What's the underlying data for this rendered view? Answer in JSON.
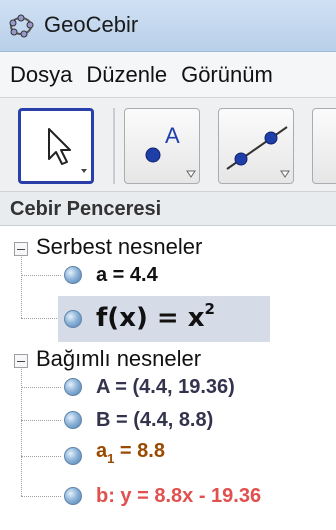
{
  "window": {
    "title": "GeoCebir",
    "icon": "geogebra-app-icon"
  },
  "menu": {
    "items": [
      "Dosya",
      "Düzenle",
      "Görünüm"
    ]
  },
  "toolbar": {
    "tools": [
      {
        "name": "move-tool",
        "icon": "arrow-cursor-icon",
        "selected": true
      },
      {
        "name": "point-tool",
        "icon": "point-icon",
        "glyph": "A",
        "selected": false
      },
      {
        "name": "line-tool",
        "icon": "line-through-points-icon",
        "selected": false
      }
    ],
    "selected_color": "#2b3fa8"
  },
  "algebra_view": {
    "title": "Cebir Penceresi",
    "groups": [
      {
        "label": "Serbest nesneler",
        "items": [
          {
            "text": "a = 4.4",
            "color": "#111111"
          },
          {
            "text_main": "f(x) = x",
            "text_sup": "2",
            "color": "#111111",
            "selected": true
          }
        ]
      },
      {
        "label": "Bağımlı nesneler",
        "items": [
          {
            "text": "A = (4.4, 19.36)",
            "color": "#33334d"
          },
          {
            "text": "B = (4.4, 8.8)",
            "color": "#33334d"
          },
          {
            "text_base": "a",
            "text_sub": "1",
            "text_rest": " = 8.8",
            "color": "#9a4a00"
          },
          {
            "text": "b: y = 8.8x - 19.36",
            "color": "#e0504f"
          }
        ]
      }
    ]
  }
}
